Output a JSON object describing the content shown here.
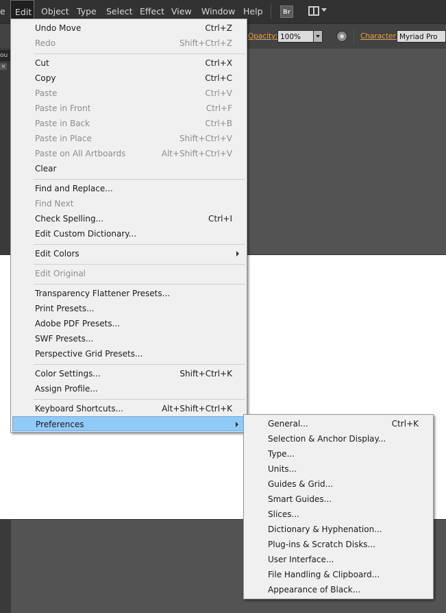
{
  "menubar": {
    "items": [
      "e",
      "Edit",
      "Object",
      "Type",
      "Select",
      "Effect",
      "View",
      "Window",
      "Help"
    ],
    "bridge_label": "Br"
  },
  "controlbar": {
    "opacity_label": "Opacity:",
    "opacity_value": "100%",
    "character_label": "Character:",
    "font_value": "Myriad Pro"
  },
  "leftpanel": {
    "tab_label": "ou",
    "close_glyph": "×"
  },
  "edit_menu": {
    "items": [
      {
        "label": "Undo Move",
        "shortcut": "Ctrl+Z"
      },
      {
        "label": "Redo",
        "shortcut": "Shift+Ctrl+Z"
      },
      {
        "label": "Cut",
        "shortcut": "Ctrl+X"
      },
      {
        "label": "Copy",
        "shortcut": "Ctrl+C"
      },
      {
        "label": "Paste",
        "shortcut": "Ctrl+V"
      },
      {
        "label": "Paste in Front",
        "shortcut": "Ctrl+F"
      },
      {
        "label": "Paste in Back",
        "shortcut": "Ctrl+B"
      },
      {
        "label": "Paste in Place",
        "shortcut": "Shift+Ctrl+V"
      },
      {
        "label": "Paste on All Artboards",
        "shortcut": "Alt+Shift+Ctrl+V"
      },
      {
        "label": "Clear",
        "shortcut": ""
      },
      {
        "label": "Find and Replace...",
        "shortcut": ""
      },
      {
        "label": "Find Next",
        "shortcut": ""
      },
      {
        "label": "Check Spelling...",
        "shortcut": "Ctrl+I"
      },
      {
        "label": "Edit Custom Dictionary...",
        "shortcut": ""
      },
      {
        "label": "Edit Colors",
        "shortcut": ""
      },
      {
        "label": "Edit Original",
        "shortcut": ""
      },
      {
        "label": "Transparency Flattener Presets...",
        "shortcut": ""
      },
      {
        "label": "Print Presets...",
        "shortcut": ""
      },
      {
        "label": "Adobe PDF Presets...",
        "shortcut": ""
      },
      {
        "label": "SWF Presets...",
        "shortcut": ""
      },
      {
        "label": "Perspective Grid Presets...",
        "shortcut": ""
      },
      {
        "label": "Color Settings...",
        "shortcut": "Shift+Ctrl+K"
      },
      {
        "label": "Assign Profile...",
        "shortcut": ""
      },
      {
        "label": "Keyboard Shortcuts...",
        "shortcut": "Alt+Shift+Ctrl+K"
      },
      {
        "label": "Preferences",
        "shortcut": ""
      }
    ]
  },
  "preferences_submenu": {
    "items": [
      {
        "label": "General...",
        "shortcut": "Ctrl+K"
      },
      {
        "label": "Selection & Anchor Display...",
        "shortcut": ""
      },
      {
        "label": "Type...",
        "shortcut": ""
      },
      {
        "label": "Units...",
        "shortcut": ""
      },
      {
        "label": "Guides & Grid...",
        "shortcut": ""
      },
      {
        "label": "Smart Guides...",
        "shortcut": ""
      },
      {
        "label": "Slices...",
        "shortcut": ""
      },
      {
        "label": "Dictionary & Hyphenation...",
        "shortcut": ""
      },
      {
        "label": "Plug-ins & Scratch Disks...",
        "shortcut": ""
      },
      {
        "label": "User Interface...",
        "shortcut": ""
      },
      {
        "label": "File Handling & Clipboard...",
        "shortcut": ""
      },
      {
        "label": "Appearance of Black...",
        "shortcut": ""
      }
    ]
  },
  "colors": {
    "menu_bg": "#f0f0f0",
    "highlight": "#91c9f7",
    "disabled_text": "#8d8d8d",
    "control_label": "#f3a13b"
  }
}
